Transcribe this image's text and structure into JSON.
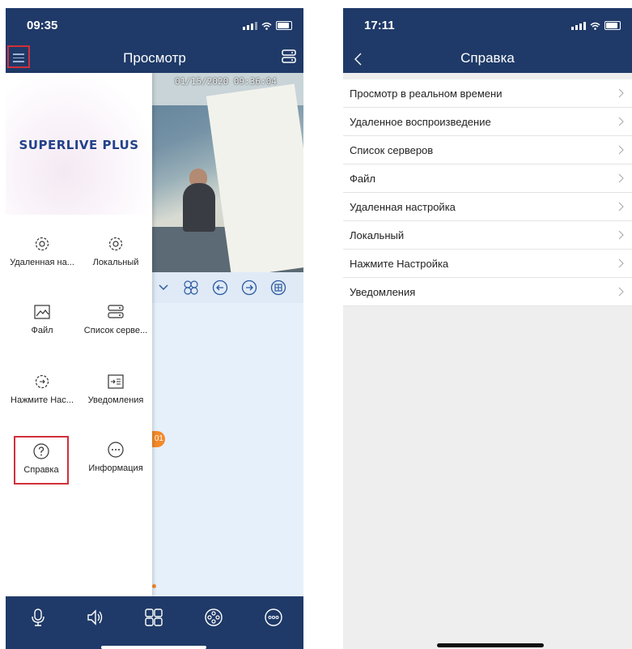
{
  "left_screen": {
    "status_time": "09:35",
    "title": "Просмотр",
    "menu_button_icon": "hamburger-menu-icon",
    "camera": {
      "timestamp": "01/15/2020 09:36:04"
    },
    "notification_badge": "01",
    "drawer": {
      "brand": "SUPERLIVE PLUS",
      "items": [
        {
          "label": "Удаленная на...",
          "icon": "remote-settings-gear-icon"
        },
        {
          "label": "Локальный",
          "icon": "local-settings-gear-icon"
        },
        {
          "label": "Файл",
          "icon": "file-image-icon"
        },
        {
          "label": "Список серве...",
          "icon": "server-list-icon"
        },
        {
          "label": "Нажмите Нас...",
          "icon": "push-settings-icon"
        },
        {
          "label": "Уведомления",
          "icon": "notifications-icon"
        },
        {
          "label": "Справка",
          "icon": "help-question-icon",
          "highlighted": true
        },
        {
          "label": "Информация",
          "icon": "info-ellipsis-icon"
        }
      ]
    },
    "tabbar_icons": [
      "microphone-icon",
      "speaker-icon",
      "grid-layout-icon",
      "reel-record-icon",
      "more-icon"
    ]
  },
  "right_screen": {
    "status_time": "17:11",
    "title": "Справка",
    "items": [
      "Просмотр в реальном времени",
      "Удаленное воспроизведение",
      "Список серверов",
      "Файл",
      "Удаленная настройка",
      "Локальный",
      "Нажмите Настройка",
      "Уведомления"
    ]
  },
  "colors": {
    "header_blue": "#1f3a68",
    "highlight_red": "#d0303a",
    "accent_orange": "#f4892a"
  }
}
